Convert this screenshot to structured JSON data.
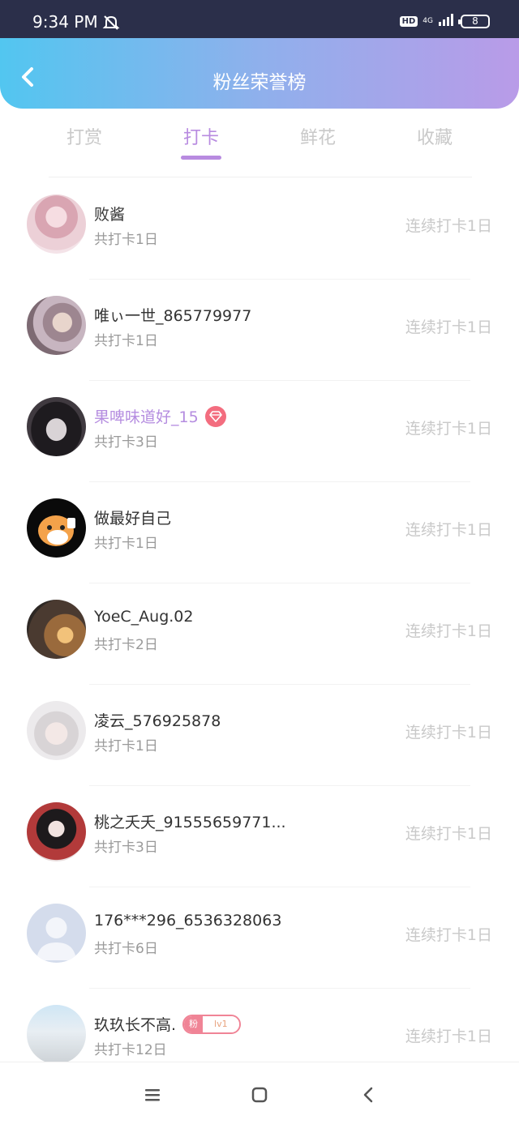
{
  "status": {
    "time": "9:34 PM",
    "hd": "HD",
    "network": "4G",
    "battery": "8"
  },
  "header": {
    "title": "粉丝荣誉榜"
  },
  "tabs": [
    {
      "label": "打赏",
      "active": false
    },
    {
      "label": "打卡",
      "active": true
    },
    {
      "label": "鲜花",
      "active": false
    },
    {
      "label": "收藏",
      "active": false
    }
  ],
  "list": [
    {
      "name": "败酱",
      "total": "共打卡1日",
      "streak": "连续打卡1日"
    },
    {
      "name": "唯ぃ一世_865779977",
      "total": "共打卡1日",
      "streak": "连续打卡1日"
    },
    {
      "name": "果啤味道好_15",
      "total": "共打卡3日",
      "streak": "连续打卡1日",
      "badge": "gem"
    },
    {
      "name": "做最好自己",
      "total": "共打卡1日",
      "streak": "连续打卡1日"
    },
    {
      "name": "YoeC_Aug.02",
      "total": "共打卡2日",
      "streak": "连续打卡1日"
    },
    {
      "name": "凌云_576925878",
      "total": "共打卡1日",
      "streak": "连续打卡1日"
    },
    {
      "name": "桃之夭夭_91555659771...",
      "total": "共打卡3日",
      "streak": "连续打卡1日"
    },
    {
      "name": "176***296_6536328063",
      "total": "共打卡6日",
      "streak": "连续打卡1日"
    },
    {
      "name": "玖玖长不高.",
      "total": "共打卡12日",
      "streak": "连续打卡1日",
      "fan_badge": {
        "label": "粉",
        "level": "lv1"
      }
    }
  ],
  "colors": {
    "accent": "#b88be0",
    "vip_name": "#b58de0",
    "gem": "#f36d7f"
  }
}
